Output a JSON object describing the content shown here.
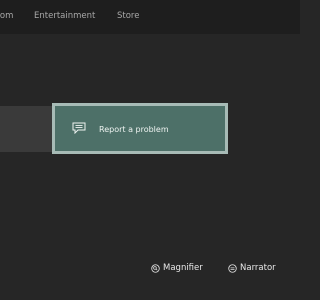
{
  "nav": {
    "tabs": [
      {
        "label": "Community"
      },
      {
        "label": "Entertainment"
      },
      {
        "label": "Store"
      }
    ]
  },
  "main": {
    "report_tile": {
      "label": "Report a problem",
      "icon": "feedback-chat-icon"
    }
  },
  "bottom_bar": {
    "magnifier": {
      "label": "Magnifier",
      "icon": "magnifier-button-icon"
    },
    "narrator": {
      "label": "Narrator",
      "icon": "narrator-button-icon"
    }
  },
  "colors": {
    "background": "#262626",
    "topbar": "#1e1e1e",
    "tile_fill": "#4d7068",
    "tile_border": "#a7bbb6"
  }
}
